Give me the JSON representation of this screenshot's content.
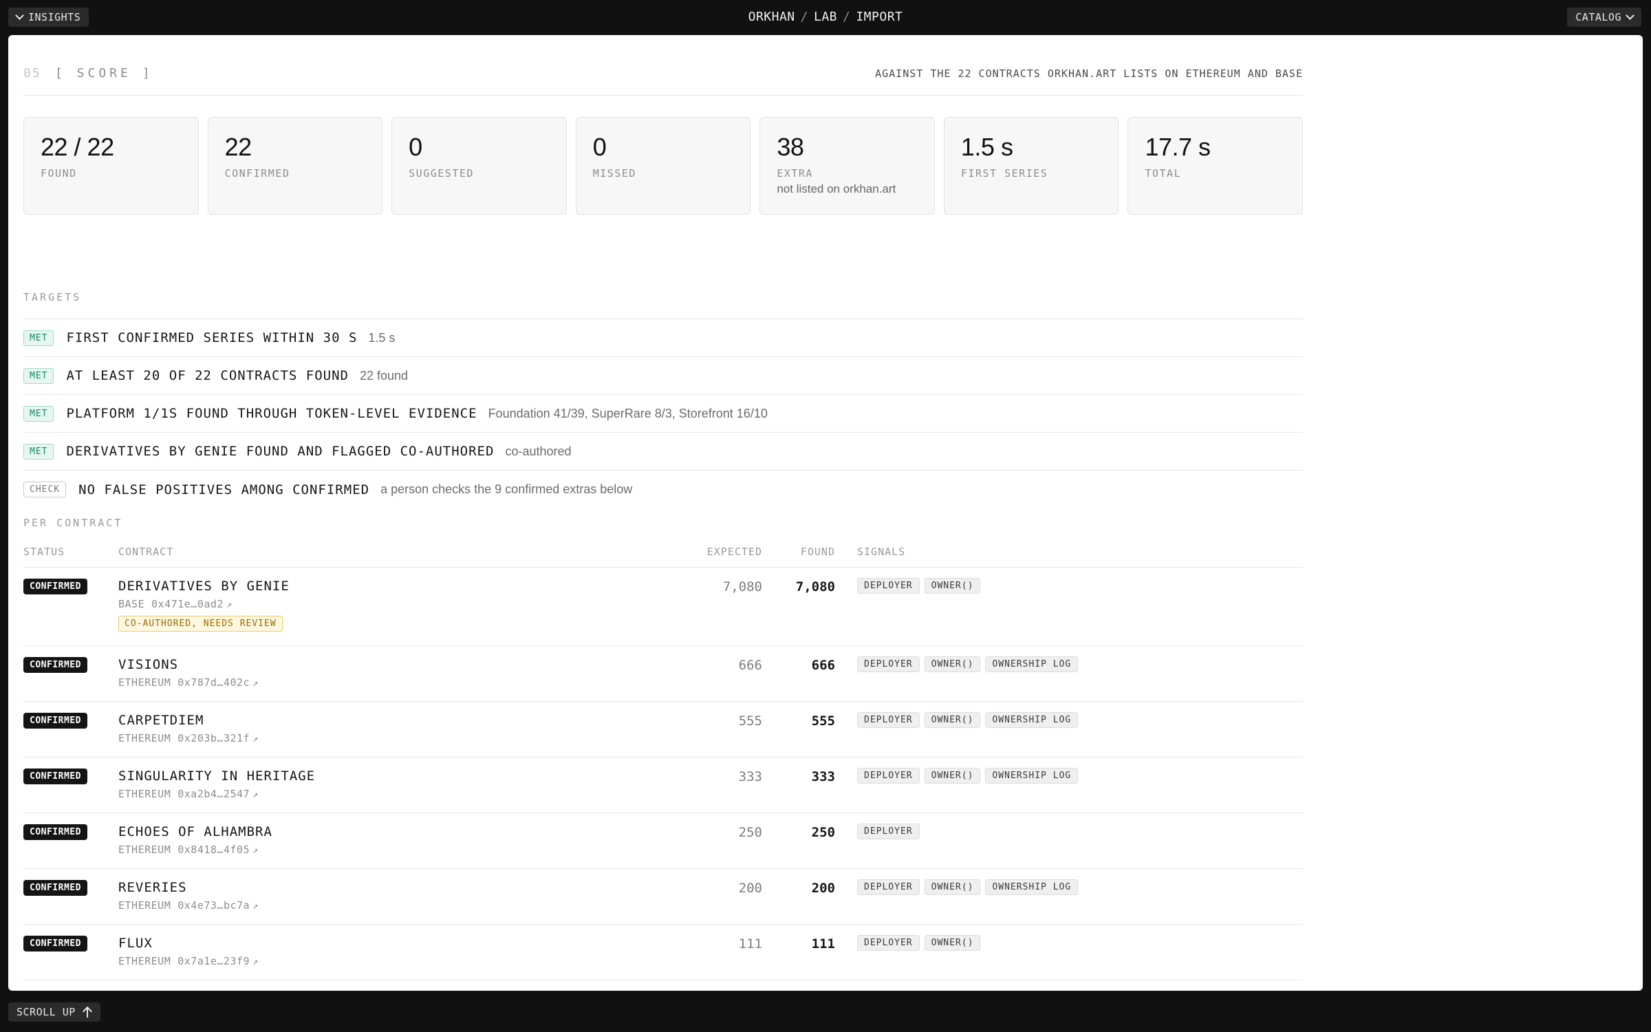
{
  "topbar": {
    "insights_label": "INSIGHTS",
    "breadcrumb": [
      "ORKHAN",
      "LAB",
      "IMPORT"
    ],
    "catalog_label": "CATALOG"
  },
  "section": {
    "number": "05",
    "title": "[ SCORE ]",
    "subtitle": "AGAINST THE 22 CONTRACTS ORKHAN.ART LISTS ON ETHEREUM AND BASE"
  },
  "stats": [
    {
      "value": "22 / 22",
      "label": "FOUND",
      "note": ""
    },
    {
      "value": "22",
      "label": "CONFIRMED",
      "note": ""
    },
    {
      "value": "0",
      "label": "SUGGESTED",
      "note": ""
    },
    {
      "value": "0",
      "label": "MISSED",
      "note": ""
    },
    {
      "value": "38",
      "label": "EXTRA",
      "note": "not listed on orkhan.art"
    },
    {
      "value": "1.5 s",
      "label": "FIRST SERIES",
      "note": ""
    },
    {
      "value": "17.7 s",
      "label": "TOTAL",
      "note": ""
    }
  ],
  "targets": {
    "label": "TARGETS",
    "items": [
      {
        "badge": "MET",
        "title": "FIRST CONFIRMED SERIES WITHIN 30 S",
        "note": "1.5 s"
      },
      {
        "badge": "MET",
        "title": "AT LEAST 20 OF 22 CONTRACTS FOUND",
        "note": "22 found"
      },
      {
        "badge": "MET",
        "title": "PLATFORM 1/1S FOUND THROUGH TOKEN-LEVEL EVIDENCE",
        "note": "Foundation 41/39, SuperRare 8/3, Storefront 16/10"
      },
      {
        "badge": "MET",
        "title": "DERIVATIVES BY GENIE FOUND AND FLAGGED CO-AUTHORED",
        "note": "co-authored"
      },
      {
        "badge": "CHECK",
        "title": "NO FALSE POSITIVES AMONG CONFIRMED",
        "note": "a person checks the 9 confirmed extras below"
      }
    ]
  },
  "per_contract": {
    "label": "PER CONTRACT",
    "columns": {
      "status": "STATUS",
      "contract": "CONTRACT",
      "expected": "EXPECTED",
      "found": "FOUND",
      "signals": "SIGNALS"
    },
    "rows": [
      {
        "status": "CONFIRMED",
        "name": "DERIVATIVES BY GENIE",
        "chain": "BASE",
        "address": "0x471e…0ad2",
        "expected": "7,080",
        "found": "7,080",
        "signals": [
          "DEPLOYER",
          "OWNER()"
        ],
        "flag": "CO-AUTHORED, NEEDS REVIEW"
      },
      {
        "status": "CONFIRMED",
        "name": "VISIONS",
        "chain": "ETHEREUM",
        "address": "0x787d…402c",
        "expected": "666",
        "found": "666",
        "signals": [
          "DEPLOYER",
          "OWNER()",
          "OWNERSHIP LOG"
        ]
      },
      {
        "status": "CONFIRMED",
        "name": "CARPETDIEM",
        "chain": "ETHEREUM",
        "address": "0x203b…321f",
        "expected": "555",
        "found": "555",
        "signals": [
          "DEPLOYER",
          "OWNER()",
          "OWNERSHIP LOG"
        ]
      },
      {
        "status": "CONFIRMED",
        "name": "SINGULARITY IN HERITAGE",
        "chain": "ETHEREUM",
        "address": "0xa2b4…2547",
        "expected": "333",
        "found": "333",
        "signals": [
          "DEPLOYER",
          "OWNER()",
          "OWNERSHIP LOG"
        ]
      },
      {
        "status": "CONFIRMED",
        "name": "ECHOES OF ALHAMBRA",
        "chain": "ETHEREUM",
        "address": "0x8418…4f05",
        "expected": "250",
        "found": "250",
        "signals": [
          "DEPLOYER"
        ]
      },
      {
        "status": "CONFIRMED",
        "name": "REVERIES",
        "chain": "ETHEREUM",
        "address": "0x4e73…bc7a",
        "expected": "200",
        "found": "200",
        "signals": [
          "DEPLOYER",
          "OWNER()",
          "OWNERSHIP LOG"
        ]
      },
      {
        "status": "CONFIRMED",
        "name": "FLUX",
        "chain": "ETHEREUM",
        "address": "0x7a1e…23f9",
        "expected": "111",
        "found": "111",
        "signals": [
          "DEPLOYER",
          "OWNER()"
        ]
      }
    ]
  },
  "footer": {
    "scroll_label": "SCROLL UP"
  },
  "icons": {
    "chevron": "chevron-down-icon",
    "external": "external-link-icon",
    "scroll": "arrow-up-icon"
  },
  "colors": {
    "background": "#111111",
    "panel": "#ffffff",
    "met": "#0f8a63",
    "review": "#9a6a00"
  }
}
